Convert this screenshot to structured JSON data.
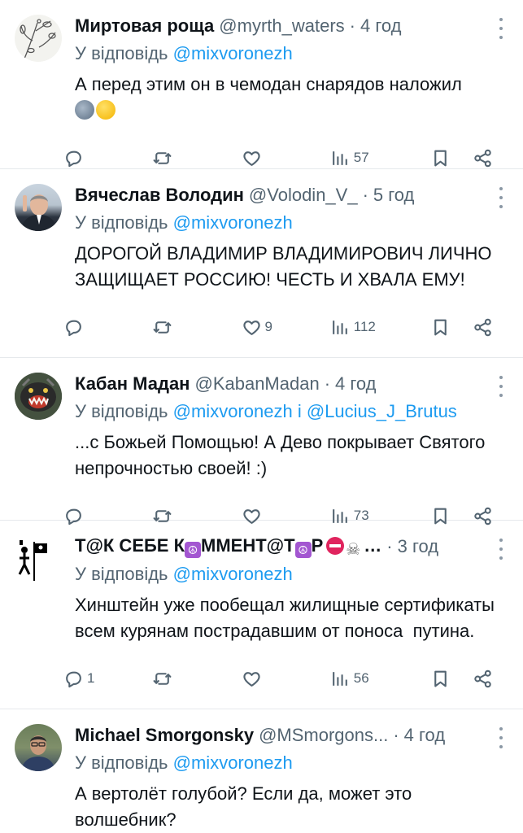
{
  "tweets": [
    {
      "name": "Миртовая роща",
      "handle": "@myrth_waters",
      "time": "4 год",
      "reply_prefix": "У відповідь ",
      "reply_to": "@mixvoronezh",
      "text": "А перед этим он в чемодан снарядов наложил",
      "emojis": [
        "new-moon-face",
        "thinking-face"
      ],
      "counts": {
        "replies": "",
        "retweets": "",
        "likes": "",
        "views": "57"
      },
      "avatar": "botanical-drawing"
    },
    {
      "name": "Вячеслав Володин",
      "handle": "@Volodin_V_",
      "time": "5 год",
      "reply_prefix": "У відповідь ",
      "reply_to": "@mixvoronezh",
      "text": "ДОРОГОЙ ВЛАДИМИР ВЛАДИМИРОВИЧ ЛИЧНО ЗАЩИЩАЕТ РОССИЮ! ЧЕСТЬ И ХВАЛА ЕМУ!",
      "counts": {
        "replies": "",
        "retweets": "",
        "likes": "9",
        "views": "112"
      },
      "avatar": "man-in-suit-photo"
    },
    {
      "name": "Кабан Мадан",
      "handle": "@KabanMadan",
      "time": "4 год",
      "reply_prefix": "У відповідь ",
      "reply_to": "@mixvoronezh",
      "reply_joiner": " і ",
      "reply_to_2": "@Lucius_J_Brutus",
      "text": "...с Божьей Помощью! А Дево покрывает Святого непрочностью своей! :)",
      "counts": {
        "replies": "",
        "retweets": "",
        "likes": "",
        "views": "73"
      },
      "avatar": "snarling-animal-photo"
    },
    {
      "name_parts": [
        "Т@К СЕБЕ К",
        "ММЕНТ@Т",
        "Р"
      ],
      "name_suffix": "…",
      "time": "3 год",
      "reply_prefix": "У відповідь ",
      "reply_to": "@mixvoronezh",
      "text": "Хинштейн уже пообещал жилищные сертификаты всем курянам пострадавшим от поноса  путина.",
      "counts": {
        "replies": "1",
        "retweets": "",
        "likes": "",
        "views": "56"
      },
      "avatar": "pirate-flag-drawing"
    },
    {
      "name": "Michael Smorgonsky",
      "handle": "@MSmorgons...",
      "time": "4 год",
      "reply_prefix": "У відповідь ",
      "reply_to": "@mixvoronezh",
      "text": "А вертолёт голубой? Если да, может это волшебник?",
      "avatar": "man-photo"
    }
  ],
  "separator": "·",
  "icons": [
    "reply-icon",
    "retweet-icon",
    "like-icon",
    "views-icon",
    "bookmark-icon",
    "share-icon",
    "more-icon"
  ],
  "colors": {
    "link": "#1d9bf0",
    "secondary": "#536471",
    "text": "#0f1419",
    "divider": "#e6e9ec"
  }
}
